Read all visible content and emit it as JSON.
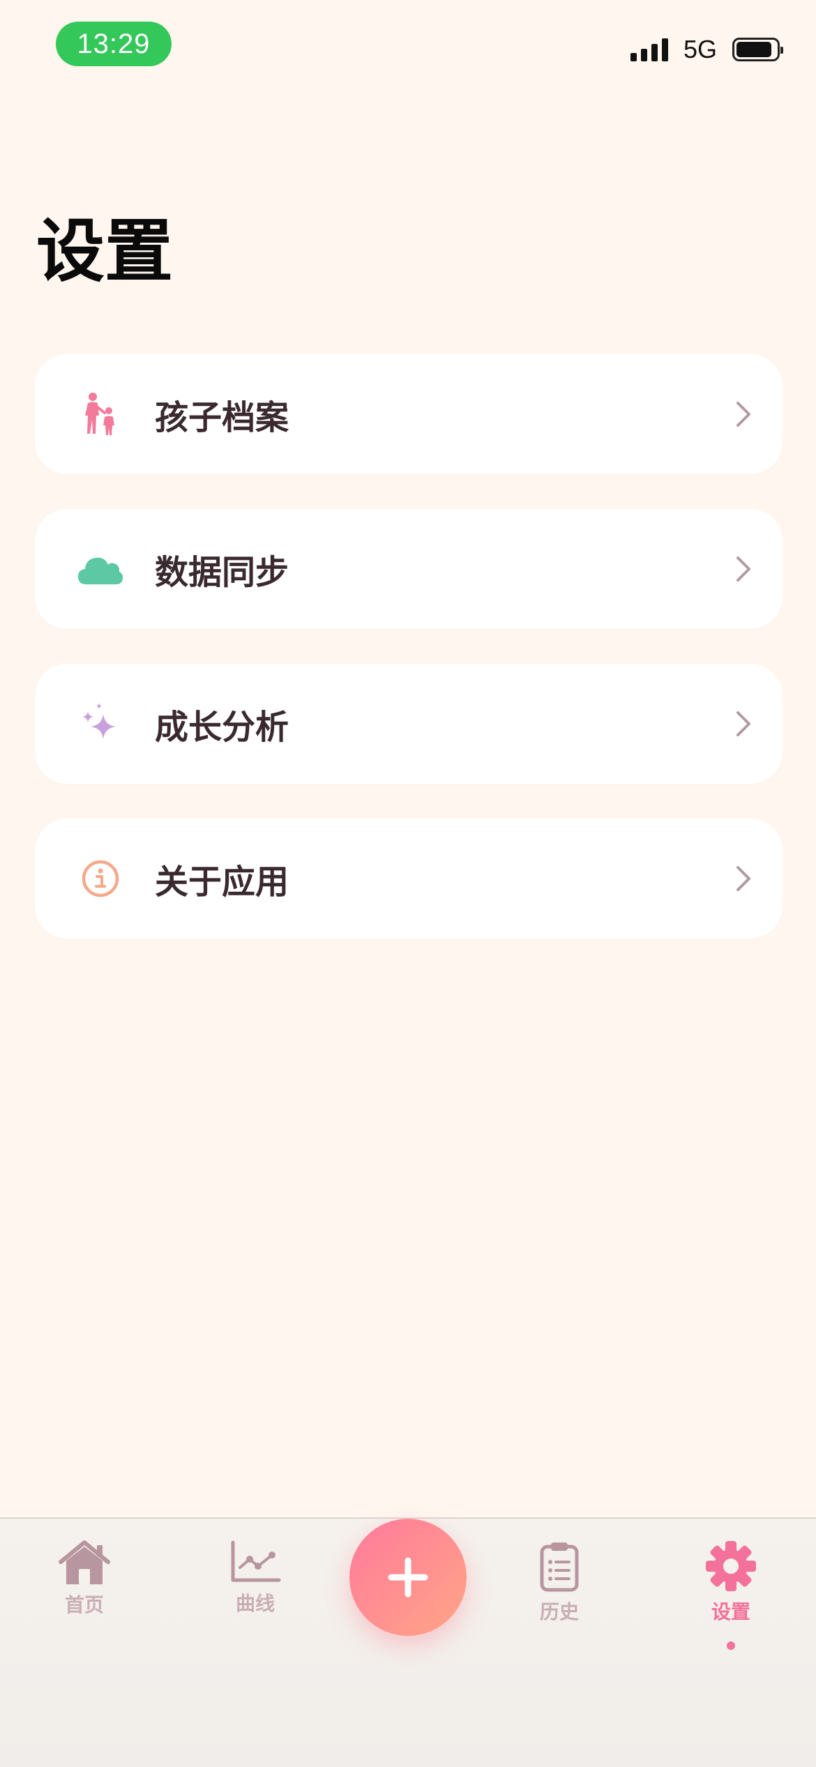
{
  "status_bar": {
    "time": "13:29",
    "network": "5G"
  },
  "page": {
    "title": "设置"
  },
  "menu": [
    {
      "label": "孩子档案",
      "icon": "family-icon",
      "color": "#F27A9B"
    },
    {
      "label": "数据同步",
      "icon": "cloud-icon",
      "color": "#5CC8A4"
    },
    {
      "label": "成长分析",
      "icon": "sparkles-icon",
      "color": "#C9A0DC"
    },
    {
      "label": "关于应用",
      "icon": "info-icon",
      "color": "#F6A98A"
    }
  ],
  "tabs": [
    {
      "label": "首页",
      "icon": "home-icon"
    },
    {
      "label": "曲线",
      "icon": "chart-icon"
    },
    {
      "label": "历史",
      "icon": "clipboard-icon"
    },
    {
      "label": "设置",
      "icon": "gear-icon",
      "active": true
    }
  ],
  "colors": {
    "background": "#FFF7EF",
    "accent": "#F3719A",
    "inactive_tab": "#C9AEB5",
    "fab_start": "#FF7A9C",
    "fab_end": "#FFA586"
  }
}
